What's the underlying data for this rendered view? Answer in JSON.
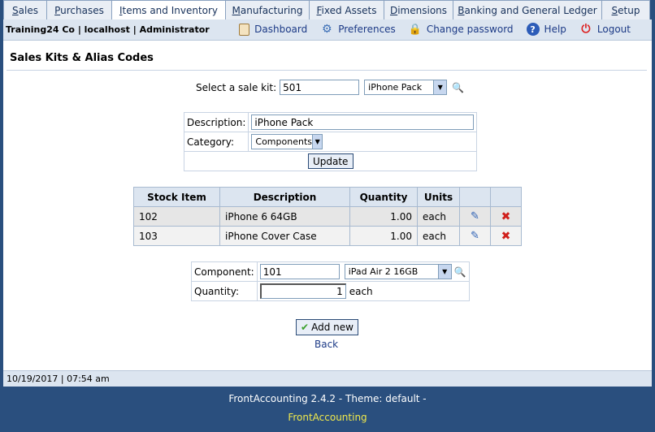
{
  "tabs": [
    {
      "label": "Sales",
      "ul": "S",
      "rest": "ales"
    },
    {
      "label": "Purchases",
      "ul": "P",
      "rest": "urchases"
    },
    {
      "label": "Items and Inventory",
      "ul": "I",
      "rest": "tems and Inventory"
    },
    {
      "label": "Manufacturing",
      "ul": "M",
      "rest": "anufacturing"
    },
    {
      "label": "Fixed Assets",
      "ul": "F",
      "rest": "ixed Assets"
    },
    {
      "label": "Dimensions",
      "ul": "D",
      "rest": "imensions"
    },
    {
      "label": "Banking and General Ledger",
      "ul": "B",
      "rest": "anking and General Ledger"
    },
    {
      "label": "Setup",
      "ul": "S",
      "rest": "etup"
    }
  ],
  "header": {
    "who": "Training24 Co | localhost | Administrator",
    "links": {
      "dashboard": "Dashboard",
      "preferences": "Preferences",
      "change_password": "Change password",
      "help": "Help",
      "logout": "Logout"
    }
  },
  "page_title": "Sales Kits & Alias Codes",
  "kit_select": {
    "label": "Select a sale kit:",
    "code": "501",
    "selected": "iPhone Pack"
  },
  "kit_form": {
    "description_label": "Description:",
    "description_value": "iPhone Pack",
    "category_label": "Category:",
    "category_value": "Components",
    "update_label": "Update"
  },
  "components_table": {
    "headers": [
      "Stock Item",
      "Description",
      "Quantity",
      "Units",
      "",
      ""
    ],
    "rows": [
      {
        "stock_item": "102",
        "description": "iPhone 6 64GB",
        "quantity": "1.00",
        "units": "each"
      },
      {
        "stock_item": "103",
        "description": "iPhone Cover Case",
        "quantity": "1.00",
        "units": "each"
      }
    ]
  },
  "add_form": {
    "component_label": "Component:",
    "component_code": "101",
    "component_selected": "iPad Air 2 16GB",
    "quantity_label": "Quantity:",
    "quantity_value": "1",
    "quantity_units": "each",
    "add_label": "Add new",
    "back_label": "Back"
  },
  "status_bar": {
    "datetime": "10/19/2017 | 07:54 am"
  },
  "footer": {
    "version": "FrontAccounting 2.4.2 - Theme: default -",
    "link": "FrontAccounting"
  },
  "colors": {
    "background": "#2a4f7e",
    "header": "#dce5f0",
    "footer_link": "#f0e94c"
  }
}
